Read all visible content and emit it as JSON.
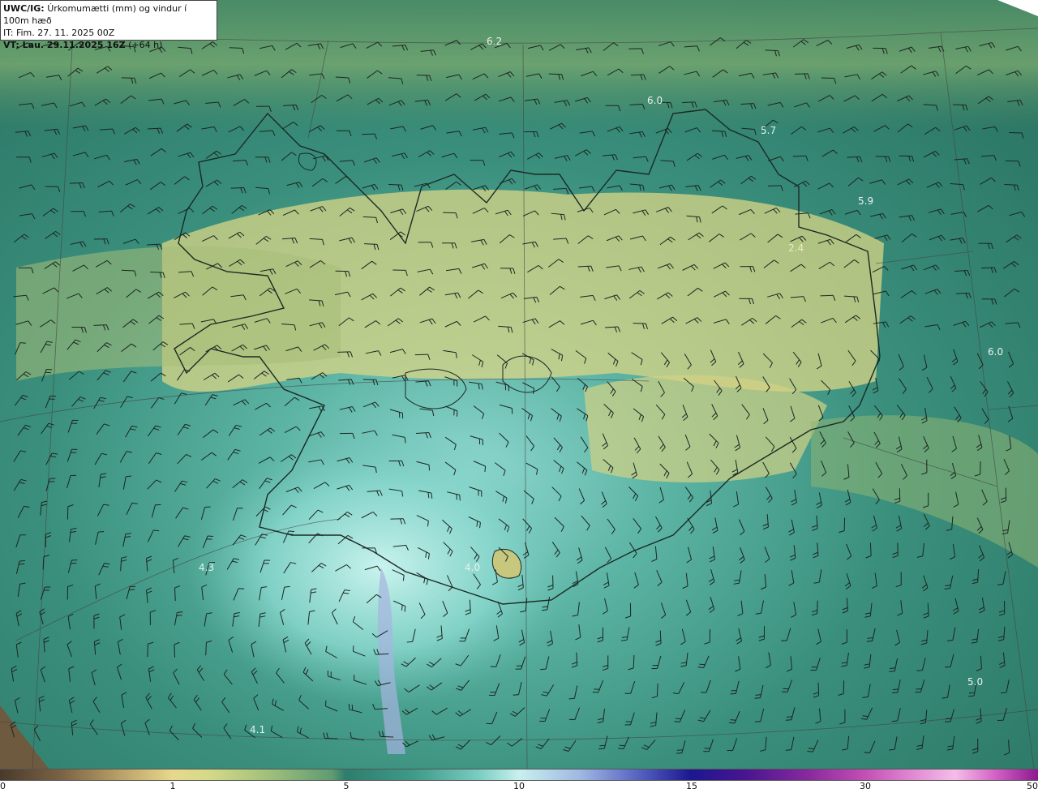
{
  "header": {
    "model": "UWC/IG:",
    "title": "Úrkomumætti (mm) og vindur í 100m hæð",
    "issue_time": "IT: Fim. 27. 11. 2025 00Z",
    "valid_time": "VT: Lau. 29.11.2025 16Z",
    "lead": "(+64 h)"
  },
  "map_labels": [
    {
      "text": "6.2"
    },
    {
      "text": "6.0"
    },
    {
      "text": "5.7"
    },
    {
      "text": "5.9"
    },
    {
      "text": "2.4"
    },
    {
      "text": "6.0"
    },
    {
      "text": "4.3"
    },
    {
      "text": "4.0"
    },
    {
      "text": "4.1"
    },
    {
      "text": "5.0"
    }
  ],
  "colorbar": {
    "ticks": [
      "0",
      "1",
      "5",
      "10",
      "15",
      "30",
      "50"
    ],
    "colors": [
      "#4a3a2c",
      "#e7d88c",
      "#2f7d6c",
      "#c8f0ef",
      "#1c1790",
      "#c24fb4",
      "#8c1a8f"
    ]
  }
}
